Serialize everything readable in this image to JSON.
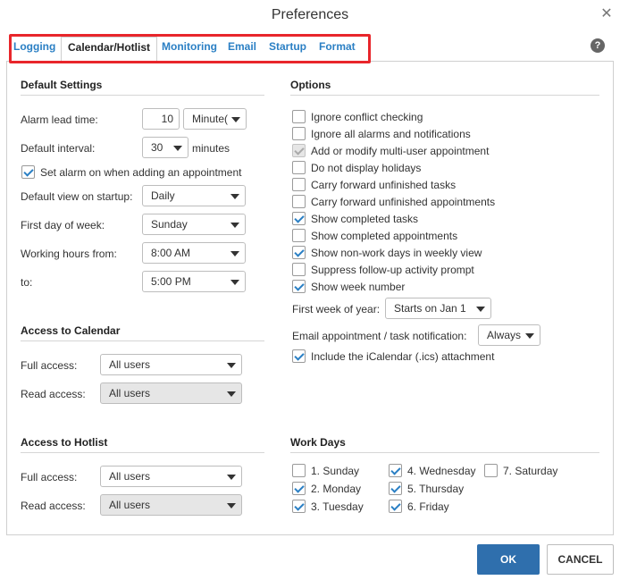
{
  "dialog": {
    "title": "Preferences"
  },
  "tabs": [
    "Logging",
    "Calendar/Hotlist",
    "Monitoring",
    "Email",
    "Startup",
    "Format"
  ],
  "help_glyph": "?",
  "default_settings": {
    "title": "Default Settings",
    "alarm_lead_time_label": "Alarm lead time:",
    "alarm_lead_time_value": "10",
    "alarm_lead_time_unit": "Minute(",
    "default_interval_label": "Default interval:",
    "default_interval_value": "30",
    "default_interval_unit": "minutes",
    "set_alarm_label": "Set alarm on when adding an appointment",
    "default_view_label": "Default view on startup:",
    "default_view_value": "Daily",
    "first_day_label": "First day of week:",
    "first_day_value": "Sunday",
    "working_from_label": "Working hours from:",
    "working_from_value": "8:00 AM",
    "working_to_label": "to:",
    "working_to_value": "5:00 PM"
  },
  "access_calendar": {
    "title": "Access to Calendar",
    "full_label": "Full access:",
    "full_value": "All users",
    "read_label": "Read access:",
    "read_value": "All users"
  },
  "access_hotlist": {
    "title": "Access to Hotlist",
    "full_label": "Full access:",
    "full_value": "All users",
    "read_label": "Read access:",
    "read_value": "All users"
  },
  "options": {
    "title": "Options",
    "items": [
      {
        "label": "Ignore conflict checking",
        "checked": false,
        "disabled": false
      },
      {
        "label": "Ignore all alarms and notifications",
        "checked": false,
        "disabled": false
      },
      {
        "label": "Add or modify multi-user appointment",
        "checked": true,
        "disabled": true
      },
      {
        "label": "Do not display holidays",
        "checked": false,
        "disabled": false
      },
      {
        "label": "Carry forward unfinished tasks",
        "checked": false,
        "disabled": false
      },
      {
        "label": "Carry forward unfinished appointments",
        "checked": false,
        "disabled": false
      },
      {
        "label": "Show completed tasks",
        "checked": true,
        "disabled": false
      },
      {
        "label": "Show completed appointments",
        "checked": false,
        "disabled": false
      },
      {
        "label": "Show non-work days in weekly view",
        "checked": true,
        "disabled": false
      },
      {
        "label": "Suppress follow-up activity prompt",
        "checked": false,
        "disabled": false
      },
      {
        "label": "Show week number",
        "checked": true,
        "disabled": false
      }
    ],
    "first_week_label": "First week of year:",
    "first_week_value": "Starts on Jan 1",
    "email_notify_label": "Email appointment / task notification:",
    "email_notify_value": "Always",
    "ics_label": "Include the iCalendar (.ics) attachment"
  },
  "work_days": {
    "title": "Work Days",
    "days": [
      {
        "label": "1. Sunday",
        "checked": false
      },
      {
        "label": "2. Monday",
        "checked": true
      },
      {
        "label": "3. Tuesday",
        "checked": true
      },
      {
        "label": "4. Wednesday",
        "checked": true
      },
      {
        "label": "5. Thursday",
        "checked": true
      },
      {
        "label": "6. Friday",
        "checked": true
      },
      {
        "label": "7. Saturday",
        "checked": false
      }
    ]
  },
  "buttons": {
    "ok": "OK",
    "cancel": "CANCEL"
  }
}
